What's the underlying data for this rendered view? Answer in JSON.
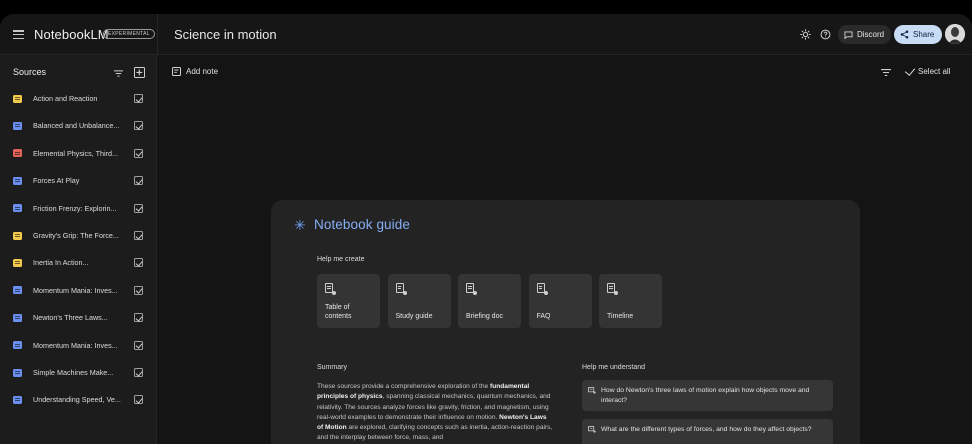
{
  "header": {
    "brand": "NotebookLM",
    "badge": "EXPERIMENTAL",
    "notebook_title": "Science in motion",
    "discord_label": "Discord",
    "share_label": "Share"
  },
  "sidebar": {
    "title": "Sources",
    "items": [
      {
        "label": "Action and Reaction",
        "icon_color": "#f2c94c",
        "checked": true
      },
      {
        "label": "Balanced and Unbalance...",
        "icon_color": "#6b8ff0",
        "checked": true
      },
      {
        "label": "Elemental Physics, Third...",
        "icon_color": "#e0635b",
        "checked": true
      },
      {
        "label": "Forces At Play",
        "icon_color": "#6b8ff0",
        "checked": true
      },
      {
        "label": "Friction Frenzy: Explorin...",
        "icon_color": "#6b8ff0",
        "checked": true
      },
      {
        "label": "Gravity's Grip: The Force...",
        "icon_color": "#f2c94c",
        "checked": true
      },
      {
        "label": "Inertia In Action...",
        "icon_color": "#f2c94c",
        "checked": true
      },
      {
        "label": "Momentum Mania: Inves...",
        "icon_color": "#6b8ff0",
        "checked": true
      },
      {
        "label": "Newton's Three Laws...",
        "icon_color": "#6b8ff0",
        "checked": true
      },
      {
        "label": "Momentum Mania: Inves...",
        "icon_color": "#6b8ff0",
        "checked": true
      },
      {
        "label": "Simple Machines Make...",
        "icon_color": "#6b8ff0",
        "checked": true
      },
      {
        "label": "Understanding Speed, Ve...",
        "icon_color": "#6b8ff0",
        "checked": true
      }
    ]
  },
  "toolbar": {
    "add_note": "Add note",
    "select_all": "Select all"
  },
  "guide": {
    "title": "Notebook guide",
    "help_create_label": "Help me create",
    "create_buttons": [
      {
        "label": "Table of contents"
      },
      {
        "label": "Study guide"
      },
      {
        "label": "Briefing doc"
      },
      {
        "label": "FAQ"
      },
      {
        "label": "Timeline"
      }
    ],
    "summary_label": "Summary",
    "summary_parts": [
      {
        "text": "These sources provide a comprehensive exploration of the ",
        "bold": false
      },
      {
        "text": "fundamental principles of physics",
        "bold": true
      },
      {
        "text": ", spanning classical mechanics, quantum mechanics, and relativity. The sources analyze forces like gravity, friction, and magnetism, using real-world examples to demonstrate their influence on motion. ",
        "bold": false
      },
      {
        "text": "Newton's Laws of Motion",
        "bold": true
      },
      {
        "text": " are explored, clarifying concepts such as inertia, action-reaction pairs, and the interplay between force, mass, and",
        "bold": false
      }
    ],
    "understand_label": "Help me understand",
    "questions": [
      {
        "text": "How do Newton's three laws of motion explain how objects move and interact?"
      },
      {
        "text": "What are the different types of forces, and how do they affect objects?"
      }
    ]
  },
  "icons": {
    "hamburger": "menu-icon",
    "theme": "sun-icon",
    "help": "help-icon",
    "discord": "chat-icon",
    "share": "share-icon",
    "sparkle": "sparkle-icon"
  }
}
